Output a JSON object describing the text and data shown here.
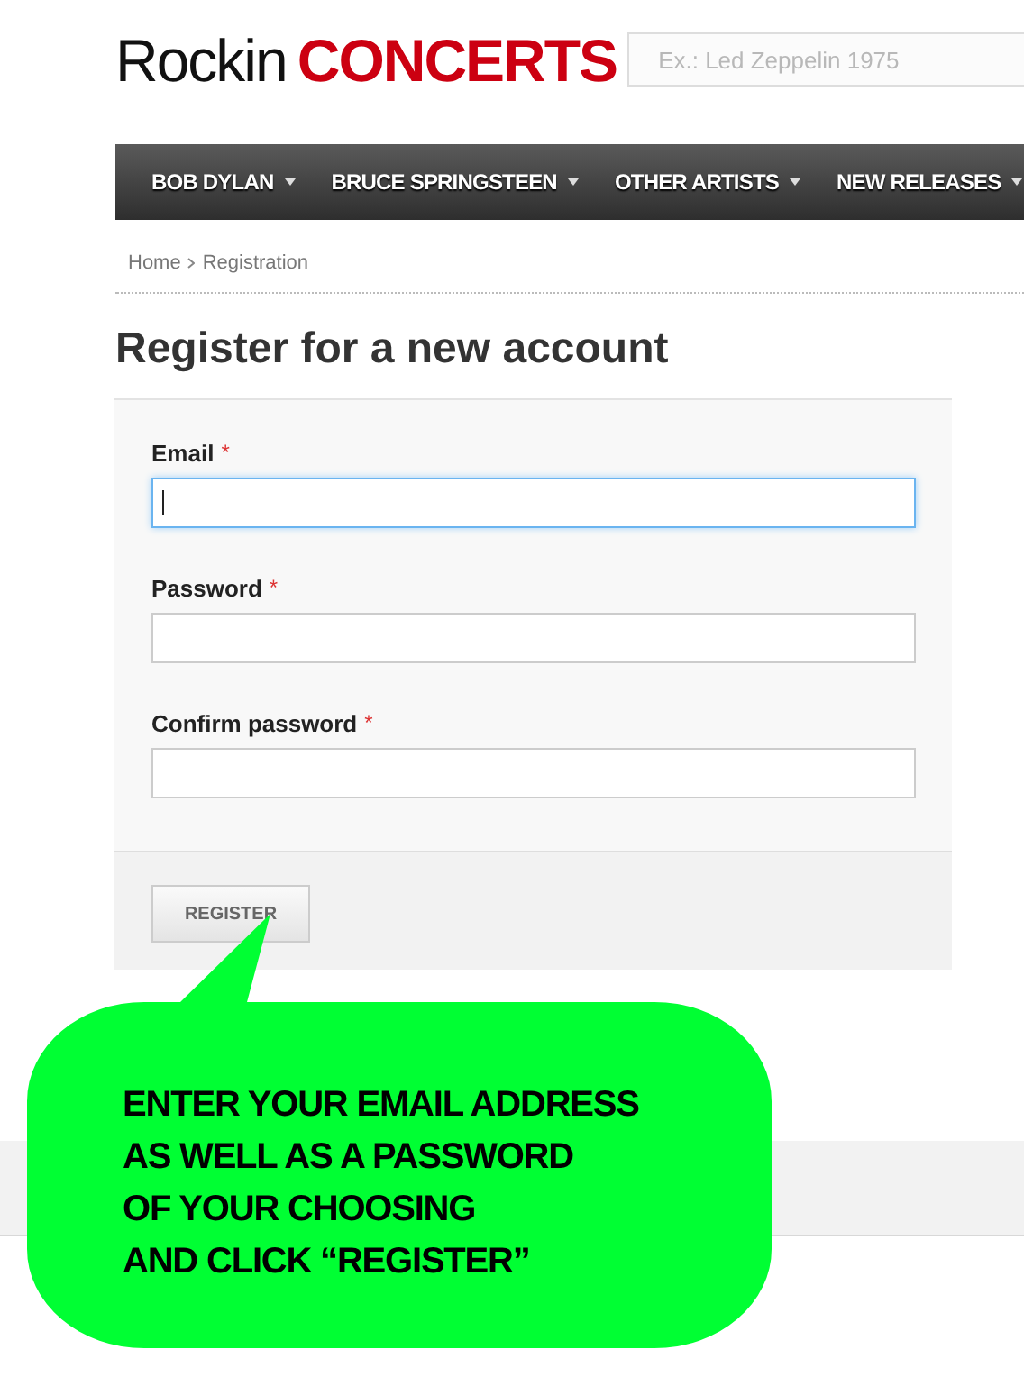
{
  "logo": {
    "part_1": "Rockin",
    "part_2": "CONCERTS"
  },
  "search": {
    "placeholder": "Ex.: Led Zeppelin 1975"
  },
  "nav": [
    {
      "label": "BOB DYLAN"
    },
    {
      "label": "BRUCE SPRINGSTEEN"
    },
    {
      "label": "OTHER ARTISTS"
    },
    {
      "label": "NEW RELEASES"
    }
  ],
  "breadcrumb": [
    "Home",
    "Registration"
  ],
  "heading": "Register for a new account",
  "fields": [
    {
      "label": "Email",
      "required_mark": "*",
      "focused": true
    },
    {
      "label": "Password",
      "required_mark": "*",
      "focused": false
    },
    {
      "label": "Confirm password",
      "required_mark": "*",
      "focused": false
    }
  ],
  "submit": "REGISTER",
  "callout": {
    "lines": [
      "ENTER YOUR EMAIL ADDRESS",
      "AS WELL AS A PASSWORD",
      "OF YOUR CHOOSING",
      "AND CLICK “REGISTER”"
    ]
  }
}
